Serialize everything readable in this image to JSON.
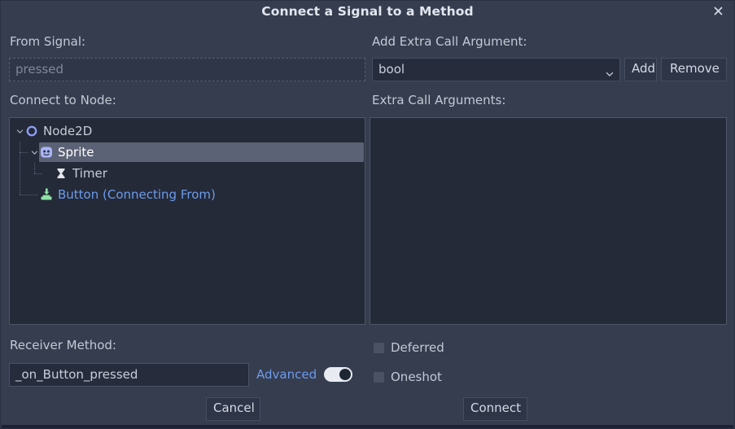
{
  "window": {
    "title": "Connect a Signal to a Method",
    "close_icon": "close-icon"
  },
  "from_signal": {
    "label": "From Signal:",
    "value": "pressed"
  },
  "extra_call_argument": {
    "label": "Add Extra Call Argument:",
    "selected_type": "bool",
    "add_label": "Add",
    "remove_label": "Remove",
    "chevron_icon": "chevron-down-icon"
  },
  "connect_to_node": {
    "label": "Connect to Node:",
    "tree": [
      {
        "name": "Node2D",
        "icon": "node2d-icon",
        "depth": 0,
        "expanded": true,
        "selected": false,
        "link": false
      },
      {
        "name": "Sprite",
        "icon": "sprite-icon",
        "depth": 1,
        "expanded": true,
        "selected": true,
        "link": false
      },
      {
        "name": "Timer",
        "icon": "timer-icon",
        "depth": 2,
        "expanded": null,
        "selected": false,
        "link": false
      },
      {
        "name": "Button (Connecting From)",
        "icon": "button-icon",
        "depth": 1,
        "expanded": null,
        "selected": false,
        "link": true
      }
    ]
  },
  "extra_call_arguments": {
    "label": "Extra Call Arguments:",
    "items": []
  },
  "receiver_method": {
    "label": "Receiver Method:",
    "value": "_on_Button_pressed"
  },
  "advanced": {
    "label": "Advanced",
    "enabled": true
  },
  "options": {
    "deferred": {
      "label": "Deferred",
      "checked": false
    },
    "oneshot": {
      "label": "Oneshot",
      "checked": false
    }
  },
  "actions": {
    "cancel_label": "Cancel",
    "connect_label": "Connect"
  },
  "colors": {
    "dialog_bg": "#353d4f",
    "panel_bg": "#242a38",
    "accent_link": "#6e9bec",
    "selection": "#5b6275",
    "node_icon": "#8d9bf0",
    "button_icon": "#8fe3a4",
    "timer_icon": "#e3e6ec"
  }
}
